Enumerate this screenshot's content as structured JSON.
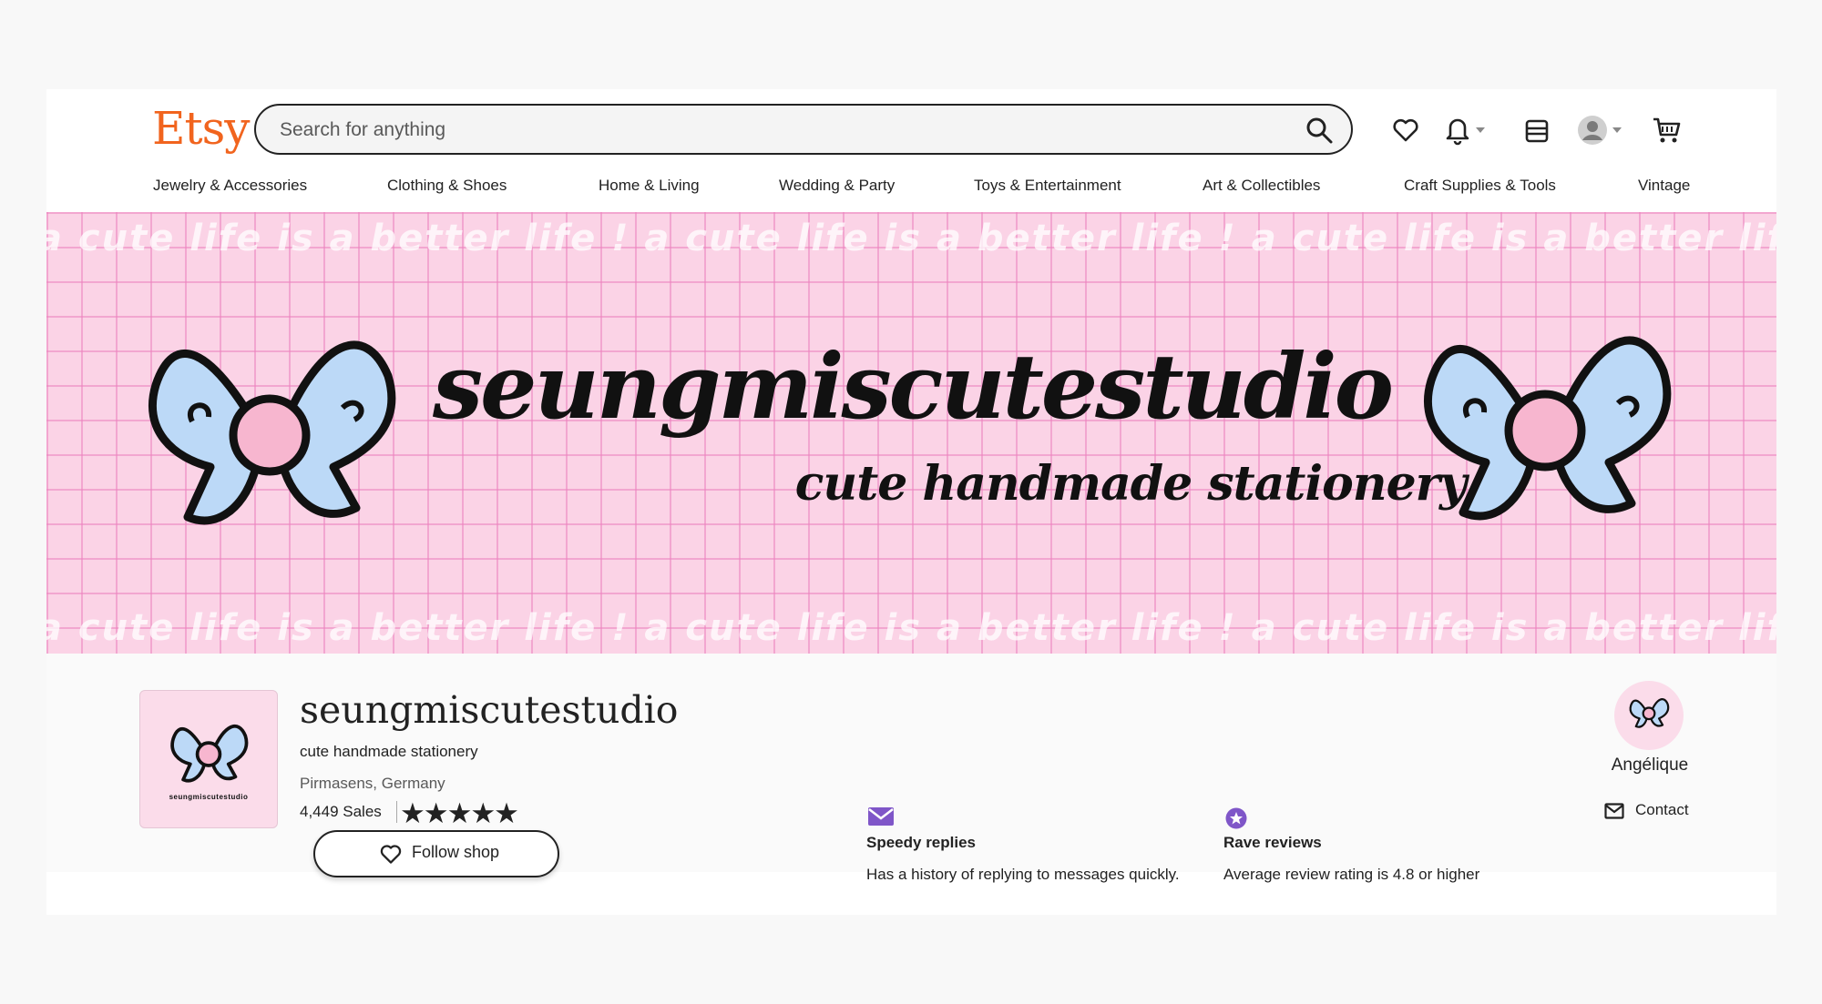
{
  "header": {
    "logo": "Etsy",
    "search_placeholder": "Search for anything",
    "icons": [
      "search-icon",
      "heart-icon",
      "bell-icon",
      "gift-icon",
      "user-avatar-icon",
      "cart-icon"
    ]
  },
  "nav": {
    "items": [
      "Jewelry & Accessories",
      "Clothing & Shoes",
      "Home & Living",
      "Wedding & Party",
      "Toys & Entertainment",
      "Art & Collectibles",
      "Craft Supplies & Tools",
      "Vintage"
    ]
  },
  "banner": {
    "title": "seungmiscutestudio",
    "subtitle": "cute handmade stationery",
    "strip_text": "a cute life is a better life ! a cute life is a better life ! a cute life is a better life !"
  },
  "shop": {
    "name": "seungmiscutestudio",
    "tagline": "cute handmade stationery",
    "location": "Pirmasens, Germany",
    "sales": "4,449 Sales",
    "rating_stars": 5,
    "stars_display": "★★★★★",
    "avatar_caption": "seungmiscutestudio",
    "follow_label": "Follow shop"
  },
  "badges": [
    {
      "icon": "mail-badge-icon",
      "title": "Speedy replies",
      "description": "Has a history of replying to messages quickly."
    },
    {
      "icon": "star-badge-icon",
      "title": "Rave reviews",
      "description": "Average review rating is 4.8 or higher"
    }
  ],
  "owner": {
    "name": "Angélique",
    "contact_label": "Contact"
  },
  "colors": {
    "brand": "#f1641e",
    "badge_purple": "#7f56c8",
    "banner_pink": "#fbd3e6",
    "bow_blue": "#bcd9f7",
    "bow_center_pink": "#f7b6cf"
  }
}
